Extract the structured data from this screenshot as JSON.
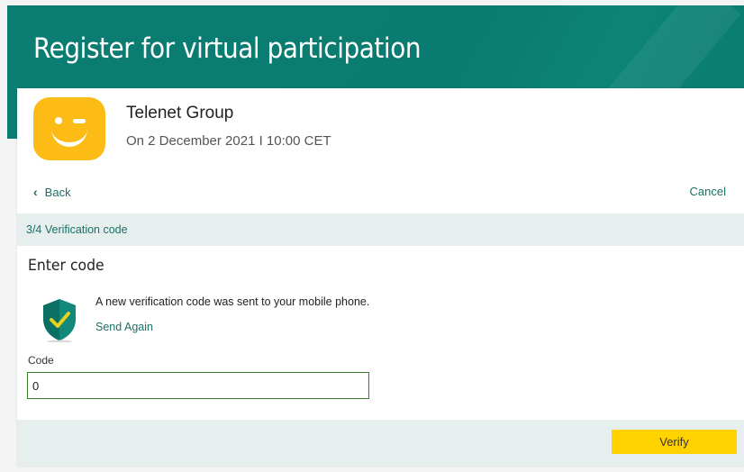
{
  "header": {
    "title": "Register for virtual participation"
  },
  "event": {
    "company": "Telenet Group",
    "date": "On 2 December 2021 I 10:00 CET",
    "logo_icon": "telenet-smiley-logo"
  },
  "nav": {
    "back_label": "Back",
    "cancel_label": "Cancel"
  },
  "step": {
    "label": "3/4 Verification code"
  },
  "verification": {
    "title": "Enter code",
    "message": "A new verification code was sent to your mobile phone.",
    "send_again_label": "Send Again",
    "icon": "shield-check-icon",
    "code_label": "Code",
    "code_value": "0"
  },
  "footer": {
    "verify_label": "Verify"
  },
  "colors": {
    "brand_teal": "#0b7d72",
    "accent_yellow": "#ffd200",
    "logo_yellow": "#fcbb15",
    "link_teal": "#1a6f66"
  }
}
